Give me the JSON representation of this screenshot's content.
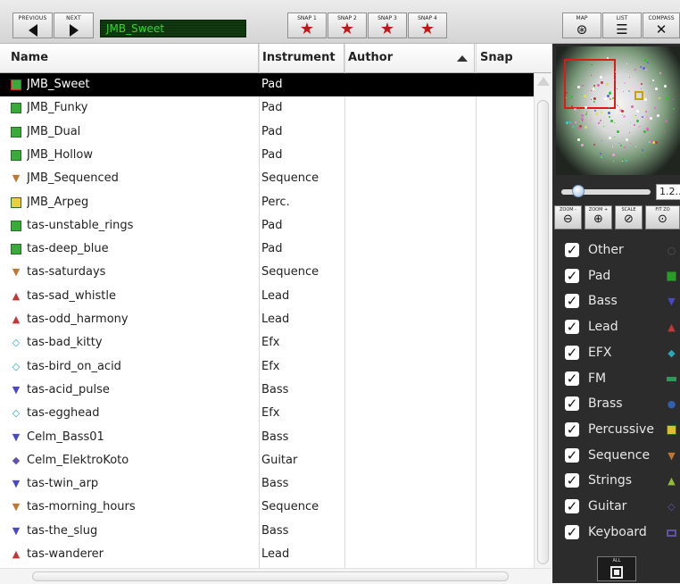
{
  "toolbar": {
    "previous_label": "PREVIOUS",
    "next_label": "NEXT",
    "current_preset": "JMB_Sweet",
    "snaps": [
      "SNAP 1",
      "SNAP 2",
      "SNAP 3",
      "SNAP 4"
    ],
    "map_label": "MAP",
    "list_label": "LIST",
    "compass_label": "COMPASS"
  },
  "table": {
    "columns": [
      "Name",
      "Instrument",
      "Author",
      "Snap"
    ],
    "sort_column": "Author",
    "selected_row": 0,
    "rows": [
      {
        "name": "JMB_Sweet",
        "instrument": "Pad",
        "icon": "square",
        "color": "#3aaa3a"
      },
      {
        "name": "JMB_Funky",
        "instrument": "Pad",
        "icon": "square",
        "color": "#3aaa3a"
      },
      {
        "name": "JMB_Dual",
        "instrument": "Pad",
        "icon": "square",
        "color": "#3aaa3a"
      },
      {
        "name": "JMB_Hollow",
        "instrument": "Pad",
        "icon": "square",
        "color": "#3aaa3a"
      },
      {
        "name": "JMB_Sequenced",
        "instrument": "Sequence",
        "icon": "triangle-down",
        "color": "#c07830"
      },
      {
        "name": "JMB_Arpeg",
        "instrument": "Perc.",
        "icon": "square",
        "color": "#e8d040"
      },
      {
        "name": "tas-unstable_rings",
        "instrument": "Pad",
        "icon": "square",
        "color": "#3aaa3a"
      },
      {
        "name": "tas-deep_blue",
        "instrument": "Pad",
        "icon": "square",
        "color": "#3aaa3a"
      },
      {
        "name": "tas-saturdays",
        "instrument": "Sequence",
        "icon": "triangle-down",
        "color": "#c07830"
      },
      {
        "name": "tas-sad_whistle",
        "instrument": "Lead",
        "icon": "triangle-up",
        "color": "#c03838"
      },
      {
        "name": "tas-odd_harmony",
        "instrument": "Lead",
        "icon": "triangle-up",
        "color": "#c03838"
      },
      {
        "name": "tas-bad_kitty",
        "instrument": "Efx",
        "icon": "diamond-outline",
        "color": "#2aa8b8"
      },
      {
        "name": "tas-bird_on_acid",
        "instrument": "Efx",
        "icon": "diamond-outline",
        "color": "#2aa8b8"
      },
      {
        "name": "tas-acid_pulse",
        "instrument": "Bass",
        "icon": "triangle-down",
        "color": "#4848c8"
      },
      {
        "name": "tas-egghead",
        "instrument": "Efx",
        "icon": "diamond-outline",
        "color": "#2aa8b8"
      },
      {
        "name": "Celm_Bass01",
        "instrument": "Bass",
        "icon": "triangle-down",
        "color": "#4848c8"
      },
      {
        "name": "Celm_ElektroKoto",
        "instrument": "Guitar",
        "icon": "diamond",
        "color": "#6050b0"
      },
      {
        "name": "tas-twin_arp",
        "instrument": "Bass",
        "icon": "triangle-down",
        "color": "#4848c8"
      },
      {
        "name": "tas-morning_hours",
        "instrument": "Sequence",
        "icon": "triangle-down",
        "color": "#c07830"
      },
      {
        "name": "tas-the_slug",
        "instrument": "Bass",
        "icon": "triangle-down",
        "color": "#4848c8"
      },
      {
        "name": "tas-wanderer",
        "instrument": "Lead",
        "icon": "triangle-up",
        "color": "#c03838"
      }
    ]
  },
  "panel": {
    "zoom_value": "1.2...",
    "zoom_buttons": [
      "ZOOM -",
      "ZOOM +",
      "SCALE",
      "FIT ZO"
    ],
    "filters": [
      {
        "label": "Other",
        "icon": "circle-outline",
        "color": "#555555"
      },
      {
        "label": "Pad",
        "icon": "square",
        "color": "#2a9a2a"
      },
      {
        "label": "Bass",
        "icon": "triangle-down",
        "color": "#4848c8"
      },
      {
        "label": "Lead",
        "icon": "triangle-up",
        "color": "#c03838"
      },
      {
        "label": "EFX",
        "icon": "diamond",
        "color": "#2aa8b8"
      },
      {
        "label": "FM",
        "icon": "bar",
        "color": "#2a9a5a"
      },
      {
        "label": "Brass",
        "icon": "circle",
        "color": "#3060b0"
      },
      {
        "label": "Percussive",
        "icon": "square",
        "color": "#d8c030"
      },
      {
        "label": "Sequence",
        "icon": "triangle-down",
        "color": "#c07830"
      },
      {
        "label": "Strings",
        "icon": "triangle-up",
        "color": "#90c030"
      },
      {
        "label": "Guitar",
        "icon": "diamond-outline",
        "color": "#6050b0"
      },
      {
        "label": "Keyboard",
        "icon": "rect-outline",
        "color": "#6050b0"
      }
    ],
    "all_label": "ALL"
  }
}
